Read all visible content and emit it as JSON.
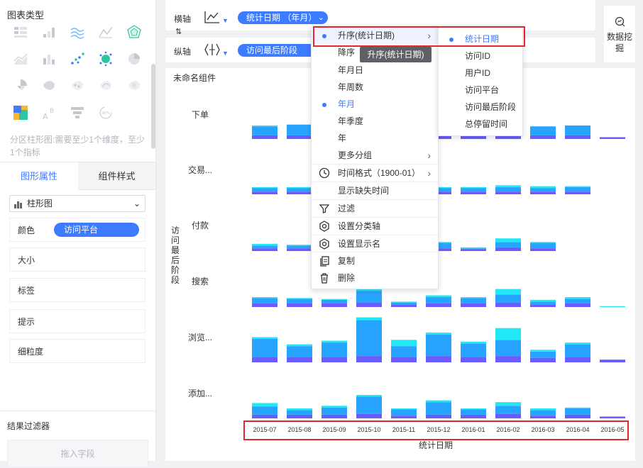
{
  "left_panel": {
    "chart_types_title": "图表类型",
    "icons": [
      "grouped-table-icon",
      "bar-chart-icon",
      "multi-line-icon",
      "line-chart-icon",
      "radar-icon",
      "area-chart-icon",
      "stacked-bar-icon",
      "scatter-icon",
      "point-cloud-icon",
      "pie-icon",
      "rose-icon",
      "china-map-icon",
      "dot-map-icon",
      "flow-map-icon",
      "heat-map-icon",
      "treemap-icon",
      "word-cloud-icon",
      "funnel-icon",
      "gauge-icon"
    ],
    "hint": "分区柱形图:需要至少1个维度，至少1个指标",
    "tabs": {
      "shape": "图形属性",
      "style": "组件样式"
    },
    "chart_type_select": "柱形图",
    "props": {
      "color": "颜色",
      "color_value": "访问平台",
      "size": "大小",
      "label": "标签",
      "tooltip": "提示",
      "granularity": "细粒度"
    },
    "filter_title": "结果过滤器",
    "filter_drop": "拖入字段"
  },
  "axis_bar": {
    "x_label": "横轴",
    "x_field": "统计日期  （年月）",
    "y_label": "纵轴",
    "y_field": "访问最后阶段",
    "mining": "数据挖掘"
  },
  "chart": {
    "component_title": "未命名组件",
    "y_axis_title": "访问最后阶段",
    "rows": [
      "下单",
      "交易...",
      "付款",
      "搜索",
      "浏览...",
      "添加..."
    ],
    "x_axis_title": "统计日期",
    "colors": {
      "series_a": "#6a5cff",
      "series_b": "#27a4ff",
      "series_c": "#22e8f5"
    }
  },
  "chart_data": {
    "type": "bar",
    "categories": [
      "2015-07",
      "2015-08",
      "2015-09",
      "2015-10",
      "2015-11",
      "2015-12",
      "2016-01",
      "2016-02",
      "2016-03",
      "2016-04",
      "2016-05"
    ],
    "series": [],
    "xlabel": "统计日期",
    "ylabel": "访问最后阶段",
    "panels": [
      {
        "name": "下单",
        "stacks": [
          [
            4,
            10,
            1
          ],
          [
            4,
            12,
            0
          ],
          [
            4,
            14,
            0
          ],
          [
            4,
            18,
            0
          ],
          [
            4,
            18,
            0
          ],
          [
            4,
            18,
            0
          ],
          [
            4,
            16,
            0
          ],
          [
            4,
            16,
            0
          ],
          [
            4,
            10,
            0
          ],
          [
            4,
            11,
            0
          ],
          [
            2,
            0,
            0
          ]
        ]
      },
      {
        "name": "交易...",
        "stacks": [
          [
            3,
            4,
            1
          ],
          [
            3,
            4,
            1
          ],
          [
            0,
            0,
            0
          ],
          [
            0,
            0,
            0
          ],
          [
            0,
            0,
            0
          ],
          [
            3,
            4,
            1
          ],
          [
            3,
            4,
            1
          ],
          [
            3,
            5,
            2
          ],
          [
            3,
            4,
            2
          ],
          [
            3,
            5,
            1
          ],
          [
            0,
            0,
            0
          ]
        ]
      },
      {
        "name": "付款",
        "stacks": [
          [
            3,
            3,
            2
          ],
          [
            3,
            3,
            1
          ],
          [
            0,
            0,
            0
          ],
          [
            0,
            0,
            0
          ],
          [
            0,
            0,
            0
          ],
          [
            3,
            6,
            1
          ],
          [
            2,
            1,
            1
          ],
          [
            4,
            6,
            4
          ],
          [
            3,
            6,
            1
          ],
          [
            0,
            0,
            0
          ],
          [
            0,
            0,
            0
          ]
        ]
      },
      {
        "name": "搜索",
        "stacks": [
          [
            4,
            6,
            1
          ],
          [
            4,
            5,
            1
          ],
          [
            4,
            4,
            1
          ],
          [
            5,
            13,
            2
          ],
          [
            3,
            2,
            1
          ],
          [
            4,
            7,
            2
          ],
          [
            4,
            6,
            1
          ],
          [
            5,
            9,
            6
          ],
          [
            3,
            3,
            2
          ],
          [
            4,
            5,
            2
          ],
          [
            0,
            0,
            1
          ]
        ]
      },
      {
        "name": "浏览...",
        "stacks": [
          [
            6,
            20,
            2
          ],
          [
            6,
            12,
            2
          ],
          [
            6,
            16,
            2
          ],
          [
            7,
            40,
            3
          ],
          [
            6,
            12,
            7
          ],
          [
            7,
            24,
            2
          ],
          [
            6,
            15,
            2
          ],
          [
            7,
            18,
            13
          ],
          [
            5,
            7,
            2
          ],
          [
            6,
            14,
            2
          ],
          [
            3,
            0,
            0
          ]
        ]
      },
      {
        "name": "添加...",
        "stacks": [
          [
            4,
            9,
            4
          ],
          [
            4,
            5,
            2
          ],
          [
            4,
            8,
            2
          ],
          [
            5,
            19,
            2
          ],
          [
            3,
            7,
            1
          ],
          [
            4,
            14,
            2
          ],
          [
            4,
            6,
            1
          ],
          [
            5,
            9,
            4
          ],
          [
            3,
            6,
            2
          ],
          [
            4,
            7,
            1
          ],
          [
            2,
            0,
            0
          ]
        ]
      }
    ]
  },
  "context_menu": {
    "items": [
      {
        "label": "升序(统计日期)",
        "selected": true,
        "arrow": true
      },
      {
        "label": "降序"
      },
      {
        "label": "年月日"
      },
      {
        "label": "年周数"
      },
      {
        "label": "年月",
        "selected": true
      },
      {
        "label": "年季度"
      },
      {
        "label": "年"
      },
      {
        "label": "更多分组",
        "arrow": true
      },
      {
        "label": "时间格式（1900-01）",
        "arrow": true,
        "icon": "clock-icon"
      },
      {
        "label": "显示缺失时间"
      },
      {
        "label": "过滤",
        "icon": "filter-icon"
      },
      {
        "label": "设置分类轴",
        "icon": "settings-icon"
      },
      {
        "label": "设置显示名",
        "icon": "settings-icon"
      },
      {
        "label": "复制",
        "icon": "copy-icon"
      },
      {
        "label": "删除",
        "icon": "trash-icon"
      }
    ],
    "tooltip": "升序(统计日期)",
    "submenu": [
      {
        "label": "统计日期",
        "selected": true
      },
      {
        "label": "访问ID"
      },
      {
        "label": "用户ID"
      },
      {
        "label": "访问平台"
      },
      {
        "label": "访问最后阶段"
      },
      {
        "label": "总停留时间"
      }
    ]
  }
}
